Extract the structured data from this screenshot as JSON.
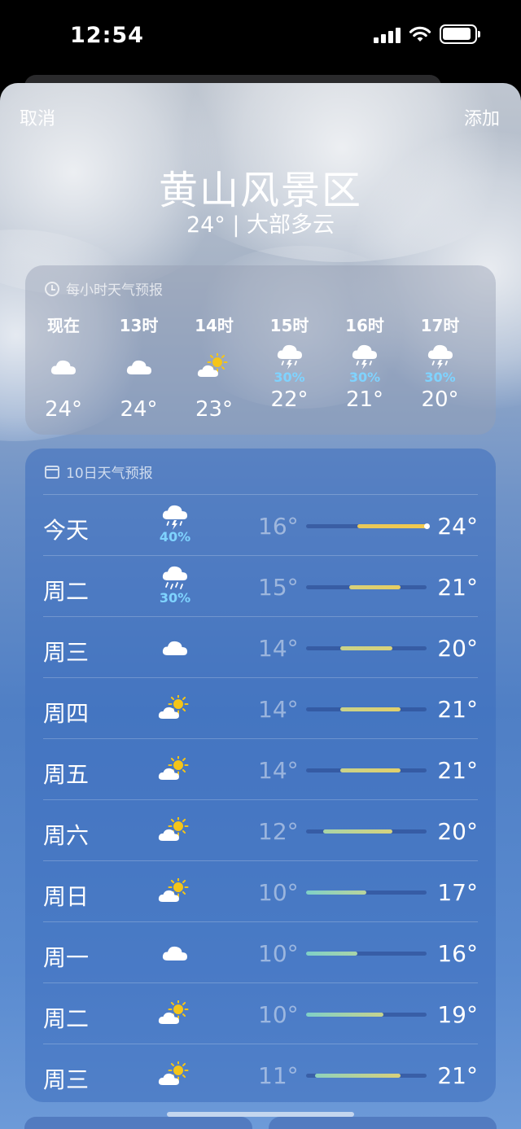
{
  "status": {
    "time": "12:54"
  },
  "nav": {
    "cancel": "取消",
    "add": "添加"
  },
  "location": {
    "name": "黄山风景区",
    "summary": "24° | 大部多云"
  },
  "hourly": {
    "title": "每小时天气预报",
    "items": [
      {
        "label": "现在",
        "icon": "cloud",
        "pop": "",
        "temp": "24°"
      },
      {
        "label": "13时",
        "icon": "cloud",
        "pop": "",
        "temp": "24°"
      },
      {
        "label": "14时",
        "icon": "partly-sunny",
        "pop": "",
        "temp": "23°"
      },
      {
        "label": "15时",
        "icon": "thunderstorm",
        "pop": "30%",
        "temp": "22°"
      },
      {
        "label": "16时",
        "icon": "thunderstorm",
        "pop": "30%",
        "temp": "21°"
      },
      {
        "label": "17时",
        "icon": "thunderstorm",
        "pop": "30%",
        "temp": "20°"
      }
    ]
  },
  "daily": {
    "title": "10日天气预报",
    "range_min": 10,
    "range_max": 24,
    "items": [
      {
        "day": "今天",
        "icon": "thunderstorm",
        "pop": "40%",
        "low": "16°",
        "high": "24°",
        "lo": 16,
        "hi": 24,
        "current": 24,
        "colors": [
          "#e9c85a",
          "#f2c94c"
        ]
      },
      {
        "day": "周二",
        "icon": "rain",
        "pop": "30%",
        "low": "15°",
        "high": "21°",
        "lo": 15,
        "hi": 21,
        "colors": [
          "#d7d07a",
          "#e6cd62"
        ]
      },
      {
        "day": "周三",
        "icon": "cloud",
        "pop": "",
        "low": "14°",
        "high": "20°",
        "lo": 14,
        "hi": 20,
        "colors": [
          "#c9d38a",
          "#d9d27a"
        ]
      },
      {
        "day": "周四",
        "icon": "partly-sunny",
        "pop": "",
        "low": "14°",
        "high": "21°",
        "lo": 14,
        "hi": 21,
        "colors": [
          "#c9d38a",
          "#e2cf6a"
        ]
      },
      {
        "day": "周五",
        "icon": "partly-sunny",
        "pop": "",
        "low": "14°",
        "high": "21°",
        "lo": 14,
        "hi": 21,
        "colors": [
          "#c9d38a",
          "#e2cf6a"
        ]
      },
      {
        "day": "周六",
        "icon": "partly-sunny",
        "pop": "",
        "low": "12°",
        "high": "20°",
        "lo": 12,
        "hi": 20,
        "colors": [
          "#a8d4a8",
          "#d6d27e"
        ]
      },
      {
        "day": "周日",
        "icon": "partly-sunny",
        "pop": "",
        "low": "10°",
        "high": "17°",
        "lo": 10,
        "hi": 17,
        "colors": [
          "#7fd0c8",
          "#b9d49c"
        ]
      },
      {
        "day": "周一",
        "icon": "cloud",
        "pop": "",
        "low": "10°",
        "high": "16°",
        "lo": 10,
        "hi": 16,
        "colors": [
          "#7fd0c8",
          "#a9d4a8"
        ]
      },
      {
        "day": "周二",
        "icon": "partly-sunny",
        "pop": "",
        "low": "10°",
        "high": "19°",
        "lo": 10,
        "hi": 19,
        "colors": [
          "#7fd0c8",
          "#c6d38e"
        ]
      },
      {
        "day": "周三",
        "icon": "partly-sunny",
        "pop": "",
        "low": "11°",
        "high": "21°",
        "lo": 11,
        "hi": 21,
        "colors": [
          "#8fd2bc",
          "#d9d07a"
        ]
      }
    ]
  }
}
